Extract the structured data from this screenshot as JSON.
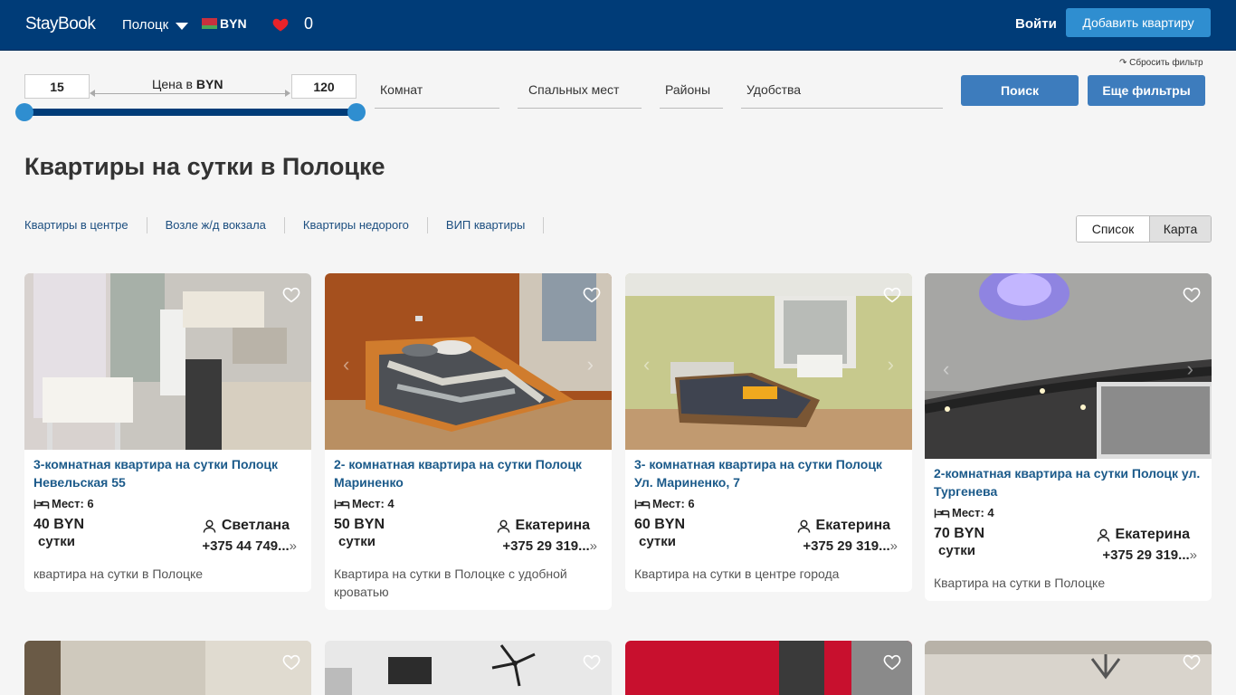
{
  "header": {
    "logo": "StayBook",
    "city": "Полоцк",
    "currency": "BYN",
    "favorites_count": "0",
    "login": "Войти",
    "add_apartment": "Добавить квартиру"
  },
  "filters": {
    "reset": "↷ Сбросить фильтр",
    "price_min": "15",
    "price_max": "120",
    "price_label_prefix": "Цена в",
    "price_label_currency": "BYN",
    "rooms": "Комнат",
    "beds": "Спальных мест",
    "districts": "Районы",
    "amenities": "Удобства",
    "search": "Поиск",
    "more_filters": "Еще фильтры"
  },
  "page_title": "Квартиры на сутки в Полоцке",
  "quick_links": [
    "Квартиры в центре",
    "Возле ж/д вокзала",
    "Квартиры недорого",
    "ВИП квартиры"
  ],
  "view": {
    "list": "Список",
    "map": "Карта"
  },
  "cards": [
    {
      "title": "3-комнатная квартира на сутки Полоцк Невельская 55",
      "seats": "Мест: 6",
      "price": "40 BYN",
      "per": "сутки",
      "host": "Светлана",
      "phone": "+375 44 749...",
      "desc": "квартира на сутки в Полоцке"
    },
    {
      "title": "2- комнатная квартира на сутки Полоцк Мариненко",
      "seats": "Мест: 4",
      "price": "50 BYN",
      "per": "сутки",
      "host": "Екатерина",
      "phone": "+375 29 319...",
      "desc": "Квартира на сутки в Полоцке с удобной кроватью"
    },
    {
      "title": "3- комнатная квартира на сутки Полоцк Ул. Мариненко, 7",
      "seats": "Мест: 6",
      "price": "60 BYN",
      "per": "сутки",
      "host": "Екатерина",
      "phone": "+375 29 319...",
      "desc": "Квартира на сутки в центре города"
    },
    {
      "title": "2-комнатная квартира на сутки Полоцк ул. Тургенева",
      "seats": "Мест: 4",
      "price": "70 BYN",
      "per": "сутки",
      "host": "Екатерина",
      "phone": "+375 29 319...",
      "desc": "Квартира на сутки в Полоцке"
    }
  ],
  "icons": {
    "heart": "heart-icon",
    "bed": "bed-icon",
    "user": "user-icon",
    "chevron": "chevron-right-double-icon"
  },
  "colors": {
    "header_bg": "#003c78",
    "accent": "#2f8ed0",
    "button": "#3d7cbd",
    "title_link": "#1b5a8a",
    "heart": "#e8232a"
  }
}
